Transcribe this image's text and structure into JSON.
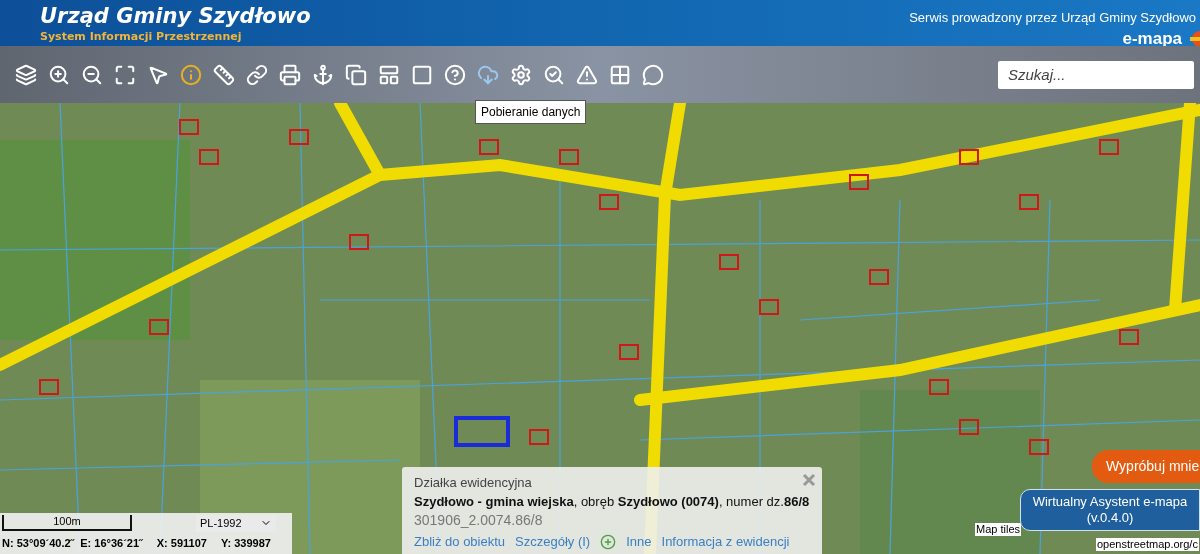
{
  "header": {
    "title": "Urząd Gminy Szydłowo",
    "subtitle": "System Informacji Przestrzennej",
    "service_text": "Serwis prowadzony przez Urząd Gminy Szydłowo",
    "logo_text": "e-mapa"
  },
  "toolbar": {
    "tooltip": "Pobieranie danych",
    "search": {
      "placeholder": "Szukaj..."
    }
  },
  "info_panel": {
    "title": "Działka ewidencyjna",
    "description": "**Szydłowo - gmina wiejska**, obręb **Szydłowo (0074)**, numer dz.**86/8**",
    "identifier": "301906_2.0074.86/8",
    "actions": [
      {
        "kind": "link",
        "label": "Zbliż do obiektu"
      },
      {
        "kind": "link",
        "label": "Szczegóły (I)"
      },
      {
        "kind": "add"
      },
      {
        "kind": "link",
        "label": "Inne"
      },
      {
        "kind": "link",
        "label": "Informacja z ewidencji"
      }
    ]
  },
  "status": {
    "scale": "100m",
    "crs": "PL-1992",
    "lat": "N: 53°09´40.2˝",
    "lon": "E: 16°36´21˝",
    "x": "X: 591107",
    "y": "Y: 339987"
  },
  "attribution": [
    "Map tiles",
    "openstreetmap.org/c"
  ],
  "try_button": "Wypróbuj mnie",
  "assistant_button": {
    "line1": "Wirtualny Asystent e-mapa",
    "line2": "(v.0.4.0)"
  }
}
